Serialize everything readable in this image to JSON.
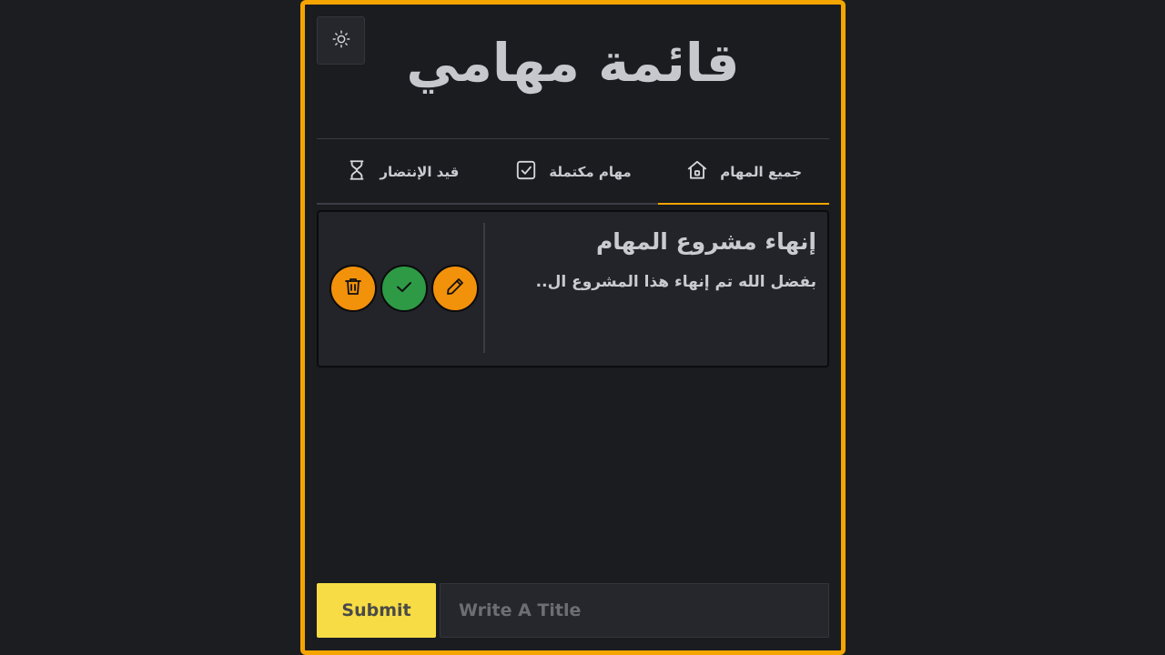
{
  "app": {
    "title": "قائمة مهامي"
  },
  "tabs": [
    {
      "label": "جميع المهام",
      "icon": "home-icon",
      "active": true
    },
    {
      "label": "مهام مكتملة",
      "icon": "check-square-icon",
      "active": false
    },
    {
      "label": "قيد الإنتضار",
      "icon": "hourglass-icon",
      "active": false
    }
  ],
  "task": {
    "title": "إنهاء مشروع المهام",
    "description": "بفضل الله تم إنهاء هذا المشروع ال..",
    "actions": {
      "edit_icon": "pencil-icon",
      "complete_icon": "check-icon",
      "delete_icon": "trash-icon"
    }
  },
  "form": {
    "submit_label": "Submit",
    "title_placeholder": "Write A Title",
    "title_value": ""
  },
  "colors": {
    "accent": "#f5a500",
    "submit": "#f7dc45",
    "action_orange": "#f2910a",
    "action_green": "#2e9a45"
  },
  "theme_toggle_icon": "sun-icon"
}
